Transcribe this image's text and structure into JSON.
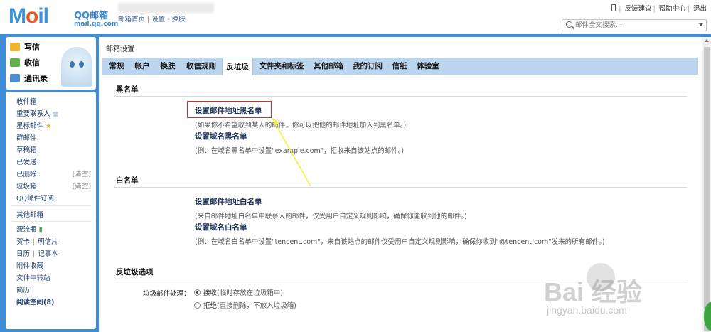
{
  "brand": {
    "logo_text": "Mail",
    "cn_name": "QQ邮箱",
    "domain": "mail.qq.com",
    "accent": "#3e8fd8"
  },
  "account": {
    "links": [
      "邮箱首页",
      "设置",
      "换肤"
    ]
  },
  "top_links": [
    "反馈建议",
    "帮助中心",
    "退出"
  ],
  "search": {
    "placeholder": "邮件全文搜索..."
  },
  "left_top": [
    {
      "label": "写信",
      "icon": "pencil-icon"
    },
    {
      "label": "收信",
      "icon": "inbox-download-icon"
    },
    {
      "label": "通讯录",
      "icon": "contacts-icon"
    }
  ],
  "folders": [
    {
      "label": "收件箱"
    },
    {
      "label": "重要联系人"
    },
    {
      "label": "星标邮件"
    },
    {
      "label": "群邮件"
    },
    {
      "label": "草稿箱"
    },
    {
      "label": "已发送"
    },
    {
      "label": "已删除",
      "action": "[清空]"
    },
    {
      "label": "垃圾箱",
      "action": "[清空]"
    },
    {
      "label": "QQ邮件订阅"
    }
  ],
  "other": {
    "label": "其他邮箱"
  },
  "apps": {
    "drift": "漂流瓶",
    "card": "贺卡",
    "postcard": "明信片",
    "calendar": "日历",
    "notes": "记事本",
    "attachments": "附件收藏",
    "transfer": "文件中转站",
    "resume": "简历",
    "reading": "阅读空间(8)"
  },
  "page_title": "邮箱设置",
  "tabs": [
    "常规",
    "帐户",
    "换肤",
    "收信规则",
    "反垃圾",
    "文件夹和标签",
    "其他邮箱",
    "我的订阅",
    "信纸",
    "体验室"
  ],
  "active_tab": "反垃圾",
  "blacklist": {
    "title": "黑名单",
    "addr_title": "设置邮件地址黑名单",
    "addr_desc": "(如果你不希望收到某人的邮件，你可以把他的邮件地址加入到黑名单。)",
    "domain_title": "设置域名黑名单",
    "domain_desc": "(例：在域名黑名单中设置\"example.com\"，拒收来自该站点的邮件。)"
  },
  "whitelist": {
    "title": "白名单",
    "addr_title": "设置邮件地址白名单",
    "addr_desc": "(来自邮件地址白名单中联系人的邮件，仅受用户自定义规则影响，确保你能收到他的邮件。)",
    "domain_title": "设置域名白名单",
    "domain_desc": "(例：在域名白名单中设置\"tencent.com\"，来自该站点的邮件仅受用户自定义规则影响，确保你收到\"@tencent.com\"发来的所有邮件。)"
  },
  "antispam": {
    "title": "反垃圾选项",
    "label": "垃圾邮件处理：",
    "opt1": "接收",
    "opt1_note": "(临时存放在垃圾箱中)",
    "opt2": "拒绝",
    "opt2_note": "(直接删除，不放入垃圾箱)",
    "selected": "接收"
  },
  "watermark": {
    "text": "Bai 经验",
    "url": "jingyan.baidu.com"
  }
}
